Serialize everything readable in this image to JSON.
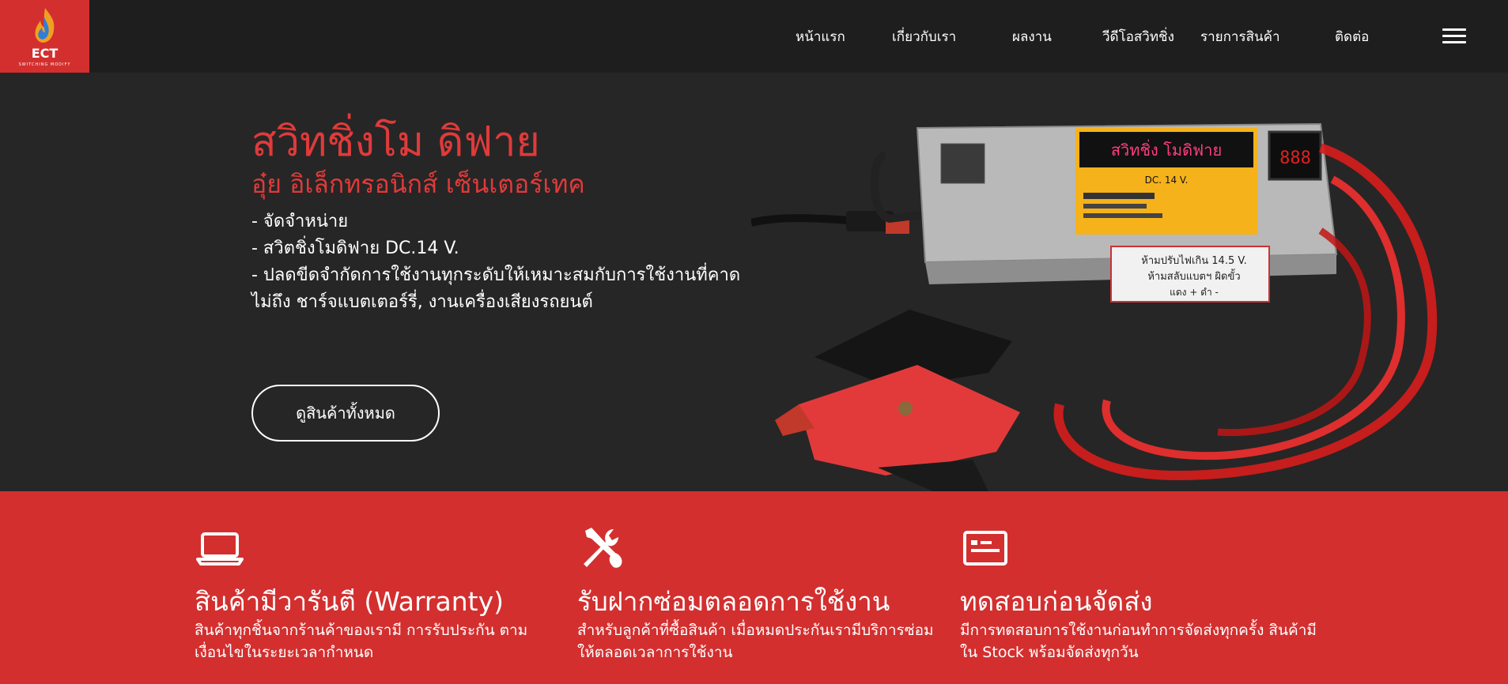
{
  "brand": {
    "logo_text": "ECT",
    "logo_sub": "SWITCHING MODIFY"
  },
  "nav": {
    "items": [
      "หน้าแรก",
      "เกี่ยวกับเรา",
      "ผลงาน",
      "วีดีโอสวิทชิ่ง",
      "รายการสินค้า",
      "ติดต่อ"
    ],
    "menu_icon": "hamburger-icon"
  },
  "hero": {
    "title": "สวิทชิ่งโม ดิฟาย",
    "subtitle": "อุ๋ย อิเล็กทรอนิกส์ เซ็นเตอร์เทค",
    "lines": [
      "- จัดจำหน่าย",
      "- สวิตชิ่งโมดิฟาย DC.14 V.",
      "- ปลดขีดจำกัดการใช้งานทุกระดับให้เหมาะสมกับการใช้งานที่คาดไม่ถึง ชาร์จแบตเตอร์รี่, งานเครื่องเสียงรถยนต์"
    ],
    "button_label": "ดูสินค้าทั้งหมด",
    "product_label_top": "สวิทชิ่ง โมดิฟาย",
    "product_label_dc": "DC. 14 V.",
    "product_sticker_line1": "ห้ามปรับไฟเกิน 14.5 V.",
    "product_sticker_line2": "ห้ามสลับแบตฯ ผิดขั้ว",
    "product_sticker_line3": "แดง + ดำ -",
    "product_meter": "888"
  },
  "features": [
    {
      "icon": "laptop-icon",
      "title": "สินค้ามีวารันตี (Warranty)",
      "desc": "สินค้าทุกชิ้นจากร้านค้าของเรามี การรับประกัน ตามเงื่อนไขในระยะเวลากำหนด"
    },
    {
      "icon": "tools-icon",
      "title": "รับฝากซ่อมตลอดการใช้งาน",
      "desc": "สำหรับลูกค้าที่ซื้อสินค้า เมื่อหมดประกันเรามีบริการซ่อมให้ตลอดเวลาการใช้งาน"
    },
    {
      "icon": "id-card-icon",
      "title": "ทดสอบก่อนจัดส่ง",
      "desc": "มีการทดสอบการใช้งานก่อนทำการจัดส่งทุกครั้ง สินค้ามีใน Stock พร้อมจัดส่งทุกวัน"
    }
  ],
  "colors": {
    "accent": "#d32f2f",
    "hero_text": "#e03a3a",
    "dark": "#242424"
  }
}
